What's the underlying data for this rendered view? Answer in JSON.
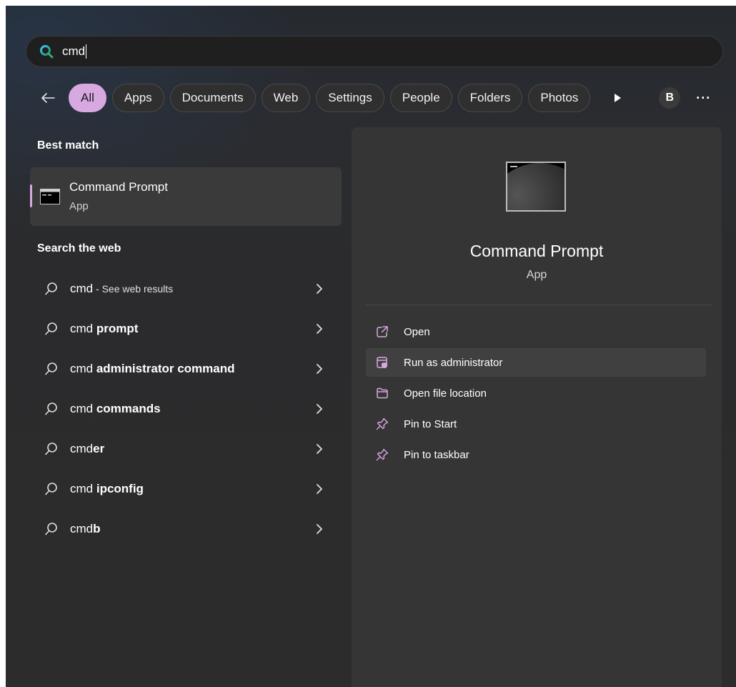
{
  "search": {
    "query": "cmd"
  },
  "filters": {
    "items": [
      "All",
      "Apps",
      "Documents",
      "Web",
      "Settings",
      "People",
      "Folders",
      "Photos"
    ],
    "avatar_letter": "B",
    "more": "···"
  },
  "best_match": {
    "title": "Best match",
    "name": "Command Prompt",
    "kind": "App"
  },
  "search_web": {
    "title": "Search the web",
    "items": [
      {
        "prefix": "cmd",
        "bold": "",
        "suffix": " - See web results"
      },
      {
        "prefix": "cmd ",
        "bold": "prompt",
        "suffix": ""
      },
      {
        "prefix": "cmd ",
        "bold": "administrator command",
        "suffix": ""
      },
      {
        "prefix": "cmd ",
        "bold": "commands",
        "suffix": ""
      },
      {
        "prefix": "cmd",
        "bold": "er",
        "suffix": ""
      },
      {
        "prefix": "cmd ",
        "bold": "ipconfig",
        "suffix": ""
      },
      {
        "prefix": "cmd",
        "bold": "b",
        "suffix": ""
      }
    ]
  },
  "preview": {
    "name": "Command Prompt",
    "kind": "App",
    "actions": [
      {
        "label": "Open",
        "icon": "open-external-icon"
      },
      {
        "label": "Run as administrator",
        "icon": "shield-admin-icon"
      },
      {
        "label": "Open file location",
        "icon": "folder-icon"
      },
      {
        "label": "Pin to Start",
        "icon": "pin-icon"
      },
      {
        "label": "Pin to taskbar",
        "icon": "pin-icon"
      }
    ]
  },
  "colors": {
    "accent": "#d8a8e0",
    "panel_bg": "#2c2c2c",
    "preview_bg": "#353535"
  }
}
